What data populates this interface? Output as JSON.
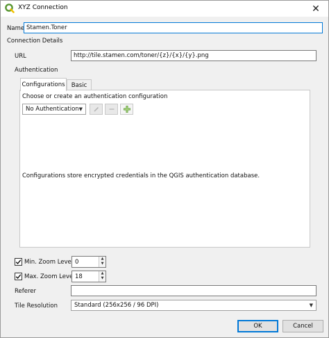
{
  "window": {
    "title": "XYZ Connection",
    "close_glyph": "✕"
  },
  "form": {
    "name_label": "Name",
    "name_value": "Stamen.Toner",
    "connection_details_label": "Connection Details",
    "url_label": "URL",
    "url_value": "http://tile.stamen.com/toner/{z}/{x}/{y}.png",
    "authentication_label": "Authentication"
  },
  "auth_tabs": [
    {
      "label": "Configurations",
      "active": true
    },
    {
      "label": "Basic",
      "active": false
    }
  ],
  "auth_config": {
    "prompt": "Choose or create an authentication configuration",
    "selected": "No Authentication",
    "info_text": "Configurations store encrypted credentials in the QGIS authentication database."
  },
  "zoom": {
    "min_label": "Min. Zoom Level",
    "min_value": "0",
    "min_checked": true,
    "max_label": "Max. Zoom Level",
    "max_value": "18",
    "max_checked": true
  },
  "referer": {
    "label": "Referer",
    "value": ""
  },
  "tile_resolution": {
    "label": "Tile Resolution",
    "selected": "Standard (256x256 / 96 DPI)"
  },
  "buttons": {
    "ok": "OK",
    "cancel": "Cancel"
  },
  "colors": {
    "accent": "#0078d7",
    "qgis_green": "#589632",
    "qgis_yellow": "#f0c000"
  }
}
